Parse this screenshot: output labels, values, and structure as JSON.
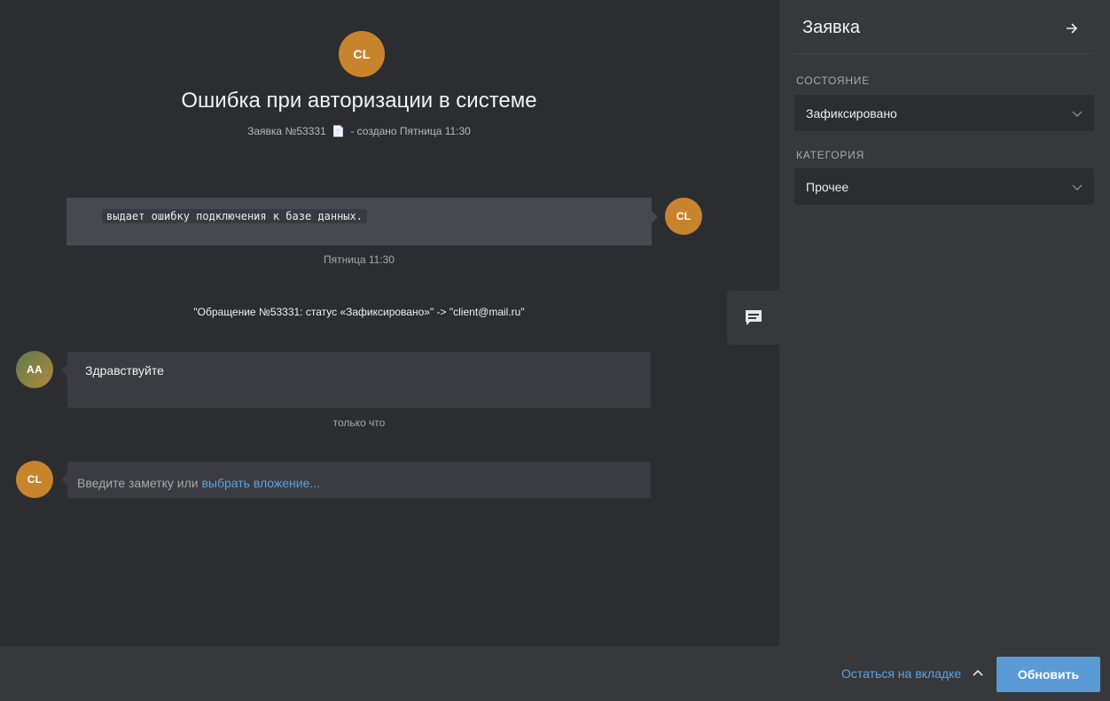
{
  "ticket": {
    "avatar_initials": "CL",
    "title": "Ошибка при авторизации в системе",
    "number_text": "Заявка №53331",
    "doc_icon": "📄",
    "created_text": "- создано Пятница 11:30"
  },
  "messages": [
    {
      "author_initials": "CL",
      "code_text": "выдает ошибку подключения к базе данных.",
      "timestamp": "Пятница 11:30"
    },
    {
      "author_initials": "AA",
      "text": "Здравствуйте",
      "timestamp": "только что"
    }
  ],
  "system_event": "\"Обращение №53331: статус «Зафиксировано»\" -> \"client@mail.ru\"",
  "composer": {
    "avatar_initials": "CL",
    "placeholder": "Введите заметку или",
    "attach_link": "выбрать вложение..."
  },
  "sidebar": {
    "title": "Заявка",
    "state_label": "СОСТОЯНИЕ",
    "state_value": "Зафиксировано",
    "category_label": "КАТЕГОРИЯ",
    "category_value": "Прочее"
  },
  "footer": {
    "stay_label": "Остаться на вкладке",
    "update_label": "Обновить"
  },
  "colors": {
    "accent": "#5b9bd5",
    "link": "#5aa3e0",
    "avatar_cl": "#c8842c",
    "background": "#2c2d31",
    "panel": "#37383c"
  }
}
